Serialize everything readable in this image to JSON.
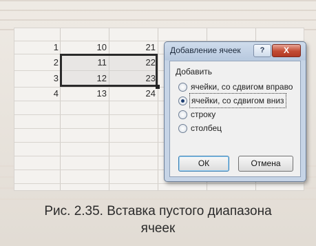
{
  "spreadsheet": {
    "rows": [
      [
        "1",
        "10",
        "21"
      ],
      [
        "2",
        "11",
        "22"
      ],
      [
        "3",
        "12",
        "23"
      ],
      [
        "4",
        "13",
        "24"
      ]
    ]
  },
  "dialog": {
    "title": "Добавление ячеек",
    "help_label": "?",
    "close_label": "X",
    "group_label": "Добавить",
    "options": [
      "ячейки, со сдвигом вправо",
      "ячейки, со сдвигом вниз",
      "строку",
      "столбец"
    ],
    "selected_option": "ячейки, со сдвигом вниз",
    "ok_label": "ОК",
    "cancel_label": "Отмена"
  },
  "caption": {
    "line1": "Рис. 2.35. Вставка пустого диапазона",
    "line2": "ячеек"
  },
  "colors": {
    "dialog_frame": "#b8c9df",
    "close_button": "#c24b33",
    "selection_border": "#2a2a2a"
  }
}
